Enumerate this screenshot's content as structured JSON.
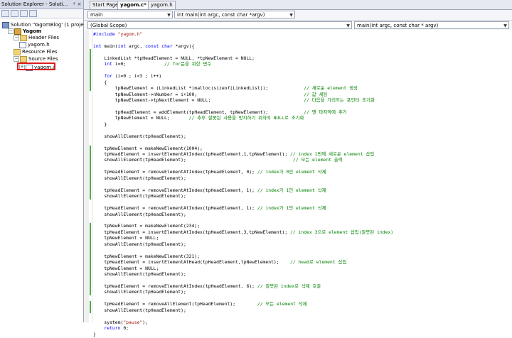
{
  "solution_explorer": {
    "title": "Solution Explorer - Soluti...",
    "pin": "ᵠ",
    "close": "×",
    "tree": [
      {
        "label": "Solution 'YagomBlog' (1 project)",
        "indent": 0,
        "type": "sol",
        "expander": ""
      },
      {
        "label": "Yagom",
        "indent": 1,
        "type": "proj",
        "expander": "−",
        "bold": true
      },
      {
        "label": "Header Files",
        "indent": 2,
        "type": "fold",
        "expander": "−"
      },
      {
        "label": "yagom.h",
        "indent": 3,
        "type": "file",
        "expander": ""
      },
      {
        "label": "Resource Files",
        "indent": 2,
        "type": "fold",
        "expander": ""
      },
      {
        "label": "Source Files",
        "indent": 2,
        "type": "fold",
        "expander": "−"
      },
      {
        "label": "yagom.c",
        "indent": 3,
        "type": "file",
        "expander": "+"
      }
    ]
  },
  "tabs": [
    {
      "label": "Start Page",
      "active": false
    },
    {
      "label": "yagom.c*",
      "active": true
    },
    {
      "label": "yagom.h",
      "active": false
    }
  ],
  "nav": {
    "file_combo": "main",
    "func_combo": "int main(int argc, const char *argv)",
    "scope_combo": "(Global Scope)",
    "member_combo": "main(int argc, const char * argv)"
  },
  "code": [
    "#include \"yagom.h\"",
    "",
    "int main(int argc, const char *argv){",
    "",
    "    LinkedList *tpHeadElement = NULL, *tpNewElement = NULL;",
    "    int i=0;              // for문을 위한 변수",
    "",
    "    for (i=0 ; i<3 ; i++)",
    "    {",
    "        tpNewElement = (LinkedList *)malloc(sizeof(LinkedList));             // 새로운 element 생성",
    "        tpNewElement->nNumber = i+100;                                       // 값 세팅",
    "        tpNewElement->tpNextElement = NULL;                                  // 다음을 가리키는 포인터 초기화",
    "",
    "        tpHeadElement = addElement(tpHeadElement, tpNewElement);             // 맨 마지막에 추가",
    "        tpNewElement = NULL;       // 추후 잘못된 사용을 방지하기 위하여 NULL로 초기화",
    "    }",
    "",
    "    showAllElement(tpHeadElement);",
    "",
    "    tpNewElement = makeNewElement(1004);",
    "    tpHeadElement = insertElementAtIndex(tpHeadElement,1,tpNewElement); // index 1번에 새로운 element 삽입",
    "    showAllElement(tpHeadElement);                                       // 모든 element 출력",
    "",
    "    tpHeadElement = removeElementAtIndex(tpHeadElement, 0); // index가 0인 element 삭제",
    "    showAllElement(tpHeadElement);",
    "",
    "    tpHeadElement = removeElementAtIndex(tpHeadElement, 1); // index가 1인 element 삭제",
    "    showAllElement(tpHeadElement);",
    "",
    "    tpHeadElement = removeElementAtIndex(tpHeadElement, 1); // index가 1인 element 삭제",
    "    showAllElement(tpHeadElement);",
    "",
    "    tpNewElement = makeNewElement(234);",
    "    tpHeadElement = insertElementAtIndex(tpHeadElement,3,tpNewElement); // index 3으로 element 삽입(잘못된 index)",
    "    tpNewElement = NULL;",
    "    showAllElement(tpHeadElement);",
    "",
    "    tpNewElement = makeNewElement(321);",
    "    tpHeadElement = insertElementAtHead(tpHeadElement,tpNewElement);    // head로 element 삽입",
    "    tpNewElement = NULL;",
    "    showAllElement(tpHeadElement);",
    "",
    "    tpHeadElement = removeElementAtIndex(tpHeadElement, 6); // 잘못된 index로 삭제 호출",
    "    showAllElement(tpHeadElement);",
    "",
    "    tpHeadElement = removeAllElement(tpHeadElement);        // 모든 element 삭제",
    "    showAllElement(tpHeadElement);",
    "",
    "    system(\"pause\");",
    "    return 0;",
    "}"
  ]
}
